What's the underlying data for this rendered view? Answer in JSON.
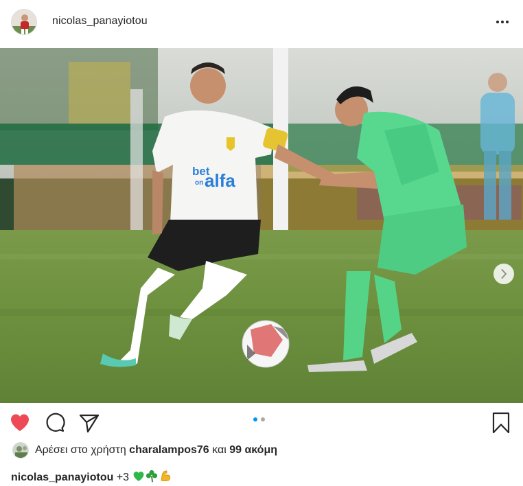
{
  "post": {
    "username": "nicolas_panayiotou",
    "more_icon": "more-horizontal-icon",
    "image": {
      "description_icon": "football-match-photo",
      "jersey_sponsor_line1": "bet",
      "jersey_sponsor_line1b": "on",
      "jersey_sponsor_line2": "alfa"
    },
    "carousel": {
      "total": 2,
      "active": 1,
      "active_color": "#0095f6",
      "inactive_color": "#a8a8a8"
    },
    "actions": {
      "like_icon": "heart-filled-icon",
      "comment_icon": "comment-icon",
      "share_icon": "share-icon",
      "save_icon": "bookmark-icon",
      "like_color": "#ed4956"
    },
    "likes": {
      "prefix": "Αρέσει στο χρήστη",
      "user": "charalampos76",
      "connector": "και",
      "others": "99 ακόμη"
    },
    "caption": {
      "username": "nicolas_panayiotou",
      "text": "+3",
      "emojis": [
        "green-heart-icon",
        "shamrock-icon",
        "flexed-biceps-icon"
      ]
    }
  }
}
